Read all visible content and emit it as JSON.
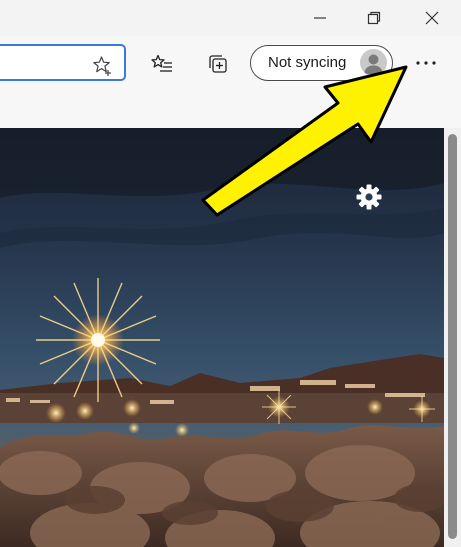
{
  "window": {
    "minimize_icon": "minimize-icon",
    "restore_icon": "restore-icon",
    "close_icon": "close-icon"
  },
  "toolbar": {
    "address_value": "",
    "favorite_icon": "star-add-icon",
    "favorites_icon": "favorites-list-icon",
    "collections_icon": "collections-icon",
    "profile_label": "Not syncing",
    "profile_icon": "avatar-icon",
    "more_icon": "more-horizontal-icon"
  },
  "page": {
    "settings_icon": "gear-icon"
  },
  "annotation": {
    "arrow_color": "#fff200",
    "arrow_outline": "#000000"
  }
}
